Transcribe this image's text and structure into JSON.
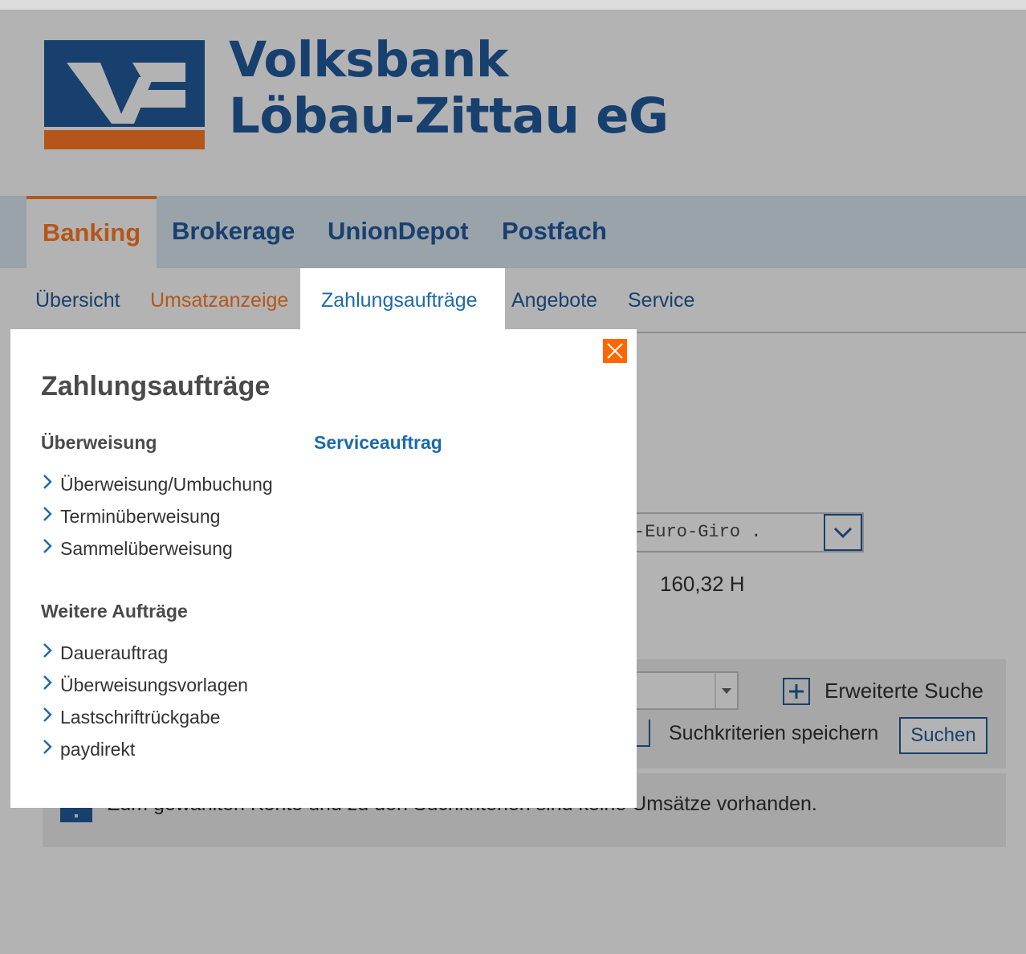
{
  "brand": {
    "line1": "Volksbank",
    "line2": "Löbau-Zittau eG",
    "colors": {
      "blue": "#17406f",
      "orange": "#b4561a"
    }
  },
  "mainnav": {
    "tabs": [
      "Banking",
      "Brokerage",
      "UnionDepot",
      "Postfach"
    ],
    "active": "Banking"
  },
  "subnav": {
    "items": [
      "Übersicht",
      "Umsatzanzeige",
      "Zahlungsaufträge",
      "Angebote",
      "Service"
    ],
    "active": "Zahlungsaufträge"
  },
  "account": {
    "name": "-Euro-Giro .",
    "balance_prefix": ":",
    "balance": "160,32 H"
  },
  "search": {
    "advanced_label": "Erweiterte Suche",
    "save_label": "Suchkriterien speichern",
    "button": "Suchen"
  },
  "info": {
    "message": "Zum gewählten Konto und zu den Suchkriterien sind keine Umsätze vorhanden."
  },
  "flyout": {
    "title": "Zahlungsaufträge",
    "sections": [
      {
        "heading": "Überweisung",
        "links": [
          "Überweisung/Umbuchung",
          "Terminüberweisung",
          "Sammelüberweisung"
        ]
      },
      {
        "heading": "Weitere Aufträge",
        "links": [
          "Dauerauftrag",
          "Überweisungsvorlagen",
          "Lastschriftrückgabe",
          "paydirekt"
        ]
      }
    ],
    "service_link": "Serviceauftrag",
    "close_icon": "close-icon"
  }
}
